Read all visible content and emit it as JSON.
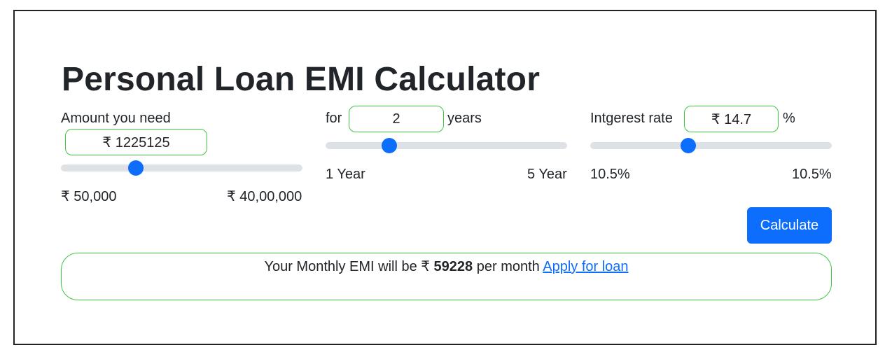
{
  "title": "Personal Loan EMI Calculator",
  "amount": {
    "label": "Amount you need",
    "value": "₹ 1225125",
    "min_label": "₹ 50,000",
    "max_label": "₹ 40,00,000",
    "slider_fraction": 0.31
  },
  "tenure": {
    "prefix": "for",
    "value": "2",
    "suffix": "years",
    "min_label": "1 Year",
    "max_label": "5 Year",
    "slider_fraction": 0.265
  },
  "interest": {
    "label": "Intgerest rate",
    "value": "₹ 14.7",
    "suffix": "%",
    "min_label": "10.5%",
    "max_label": "10.5%",
    "slider_fraction": 0.405
  },
  "calculate_label": "Calculate",
  "result": {
    "prefix": "Your Monthly EMI will be ₹",
    "emi": "59228",
    "suffix": "per month",
    "apply_link": "Apply for loan"
  },
  "colors": {
    "accent": "#0d6efd",
    "field_border": "#3fc63f",
    "track": "#dee2e6",
    "text": "#212529"
  }
}
